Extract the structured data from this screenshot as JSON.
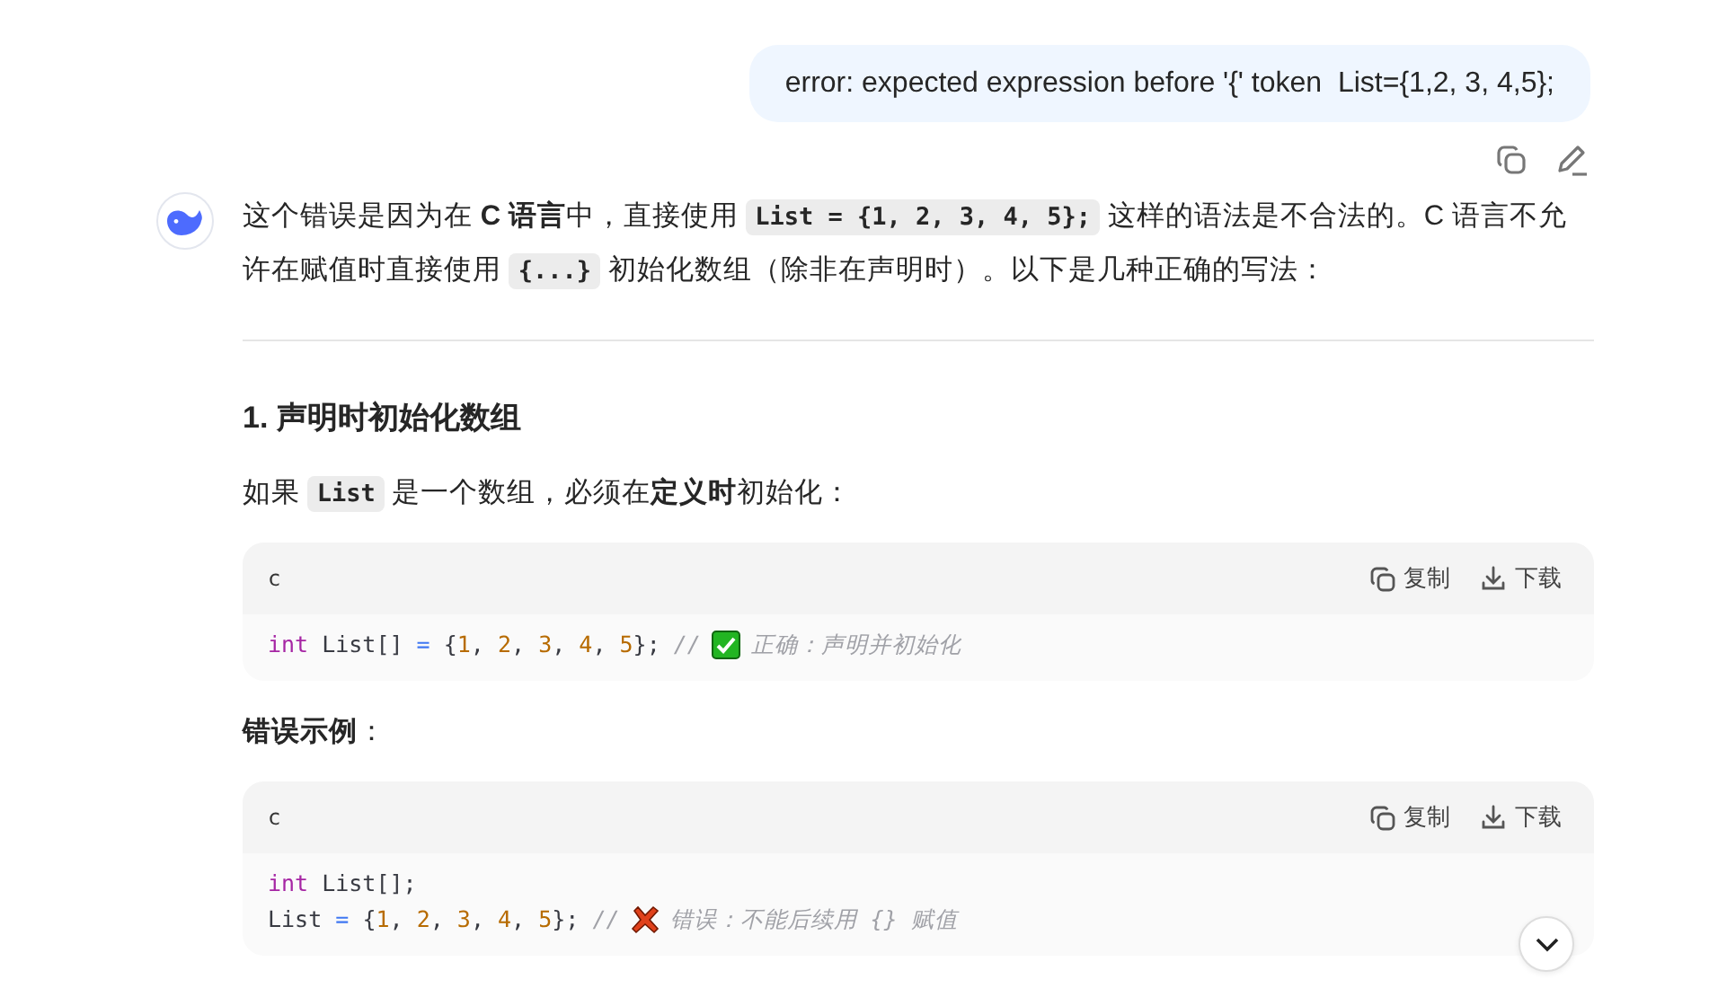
{
  "user_message": {
    "text": "error: expected expression before '{' token  List={1,2, 3, 4,5};"
  },
  "answer": {
    "intro": [
      {
        "kind": "text",
        "text": "这个错误是因为在 "
      },
      {
        "kind": "bold",
        "text": "C 语言"
      },
      {
        "kind": "text",
        "text": "中，直接使用 "
      },
      {
        "kind": "code",
        "text": "List = {1, 2, 3, 4, 5};"
      },
      {
        "kind": "text",
        "text": " 这样的语法是不合法的。C 语言不允许在赋值时直接使用 "
      },
      {
        "kind": "code",
        "text": "{...}"
      },
      {
        "kind": "text",
        "text": " 初始化数组（除非在声明时）。以下是几种正确的写法："
      }
    ],
    "sections": [
      {
        "kind": "heading",
        "text": "1. 声明时初始化数组"
      },
      {
        "kind": "paragraph",
        "parts": [
          {
            "kind": "text",
            "text": "如果 "
          },
          {
            "kind": "code",
            "text": "List"
          },
          {
            "kind": "text",
            "text": " 是一个数组，必须在"
          },
          {
            "kind": "bold",
            "text": "定义时"
          },
          {
            "kind": "text",
            "text": "初始化："
          }
        ]
      },
      {
        "kind": "codeblock",
        "language": "c",
        "copy": "复制",
        "download": "下载",
        "lines": [
          [
            {
              "kind": "keyword",
              "text": "int"
            },
            {
              "kind": "plain",
              "text": " List[] "
            },
            {
              "kind": "op",
              "text": "="
            },
            {
              "kind": "plain",
              "text": " {"
            },
            {
              "kind": "num",
              "text": "1"
            },
            {
              "kind": "plain",
              "text": ", "
            },
            {
              "kind": "num",
              "text": "2"
            },
            {
              "kind": "plain",
              "text": ", "
            },
            {
              "kind": "num",
              "text": "3"
            },
            {
              "kind": "plain",
              "text": ", "
            },
            {
              "kind": "num",
              "text": "4"
            },
            {
              "kind": "plain",
              "text": ", "
            },
            {
              "kind": "num",
              "text": "5"
            },
            {
              "kind": "plain",
              "text": "}; "
            },
            {
              "kind": "comment",
              "text": "//"
            },
            {
              "kind": "ok-mark"
            },
            {
              "kind": "comment",
              "text": "正确：声明并初始化"
            }
          ]
        ]
      },
      {
        "kind": "paragraph",
        "parts": [
          {
            "kind": "bold",
            "text": "错误示例"
          },
          {
            "kind": "text",
            "text": "："
          }
        ]
      },
      {
        "kind": "codeblock",
        "language": "c",
        "copy": "复制",
        "download": "下载",
        "lines": [
          [
            {
              "kind": "keyword",
              "text": "int"
            },
            {
              "kind": "plain",
              "text": " List[];"
            }
          ],
          [
            {
              "kind": "plain",
              "text": "List "
            },
            {
              "kind": "op",
              "text": "="
            },
            {
              "kind": "plain",
              "text": " {"
            },
            {
              "kind": "num",
              "text": "1"
            },
            {
              "kind": "plain",
              "text": ", "
            },
            {
              "kind": "num",
              "text": "2"
            },
            {
              "kind": "plain",
              "text": ", "
            },
            {
              "kind": "num",
              "text": "3"
            },
            {
              "kind": "plain",
              "text": ", "
            },
            {
              "kind": "num",
              "text": "4"
            },
            {
              "kind": "plain",
              "text": ", "
            },
            {
              "kind": "num",
              "text": "5"
            },
            {
              "kind": "plain",
              "text": "}; "
            },
            {
              "kind": "comment",
              "text": "//"
            },
            {
              "kind": "error-mark"
            },
            {
              "kind": "comment",
              "text": "错误：不能后续用 {} 赋值"
            }
          ]
        ]
      }
    ]
  }
}
